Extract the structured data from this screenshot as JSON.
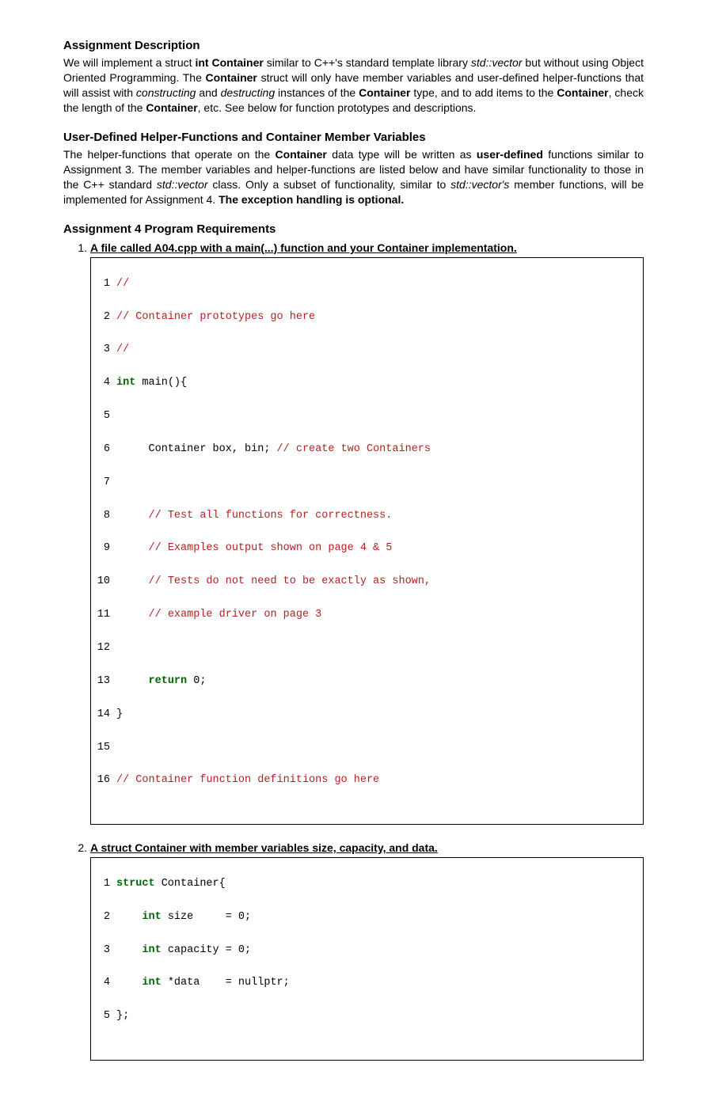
{
  "section1": {
    "title": "Assignment Description",
    "intro_before": "We will implement a struct ",
    "int_container": "int Container",
    "intro_mid1": " similar to C++'s standard template library ",
    "stdvec": "std::vector",
    "intro_mid2": " but without using Object Oriented Programming.  The ",
    "container1": "Container",
    "intro_mid3": " struct will only have member variables and user-defined helper-functions that will assist with ",
    "constructing": "constructing",
    "and": " and ",
    "destructing": "destructing",
    "intro_mid4": " instances of the ",
    "container2": "Container",
    "intro_mid5": " type, and to add items to the ",
    "container3": "Container",
    "intro_mid6": ", check the length of the ",
    "container4": "Container",
    "intro_end": ", etc.  See below for function prototypes and descriptions."
  },
  "section2": {
    "title": "User-Defined Helper-Functions and Container Member Variables",
    "p1a": "The helper-functions that operate on the ",
    "container": "Container",
    "p1b": " data type will be written as ",
    "userdef": "user-defined",
    "p1c": " functions similar to Assignment 3.  The member variables and helper-functions are listed below and have similar functionality to those in the C++ standard ",
    "stdvec": "std::vector",
    "p1d": " class.  Only a subset of functionality, similar to ",
    "stdvec2": "std::vector's",
    "p1e": " member functions, will be implemented for Assignment 4.  ",
    "excopt": "The exception handling is optional."
  },
  "section3": {
    "title": "Assignment 4 Program Requirements"
  },
  "req1": {
    "head": "A file called A04.cpp with a main(...) function and your Container implementation."
  },
  "code1": {
    "l1": {
      "n": "1",
      "c": "//"
    },
    "l2": {
      "n": "2",
      "c": "// Container prototypes go here"
    },
    "l3": {
      "n": "3",
      "c": "//"
    },
    "l4": {
      "n": "4",
      "kw": "int",
      "rest": " main(){"
    },
    "l5": {
      "n": "5",
      "t": ""
    },
    "l6": {
      "n": "6",
      "t": "     Container box, bin; ",
      "c": "// create two Containers"
    },
    "l7": {
      "n": "7",
      "t": ""
    },
    "l8": {
      "n": "8",
      "t": "     ",
      "c": "// Test all functions for correctness."
    },
    "l9": {
      "n": "9",
      "t": "     ",
      "c": "// Examples output shown on page 4 & 5"
    },
    "l10": {
      "n": "10",
      "t": "     ",
      "c": "// Tests do not need to be exactly as shown,"
    },
    "l11": {
      "n": "11",
      "t": "     ",
      "c": "// example driver on page 3"
    },
    "l12": {
      "n": "12",
      "t": ""
    },
    "l13": {
      "n": "13",
      "t": "     ",
      "kw": "return",
      "rest": " 0;"
    },
    "l14": {
      "n": "14",
      "t": "}"
    },
    "l15": {
      "n": "15",
      "t": ""
    },
    "l16": {
      "n": "16",
      "c": "// Container function definitions go here"
    }
  },
  "req2": {
    "head": "A struct Container with member variables size, capacity, and data."
  },
  "code2": {
    "l1": {
      "n": "1",
      "kw": "struct",
      "rest": " Container{"
    },
    "l2": {
      "n": "2",
      "t": "    ",
      "kw": "int",
      "rest": " size     = 0;"
    },
    "l3": {
      "n": "3",
      "t": "    ",
      "kw": "int",
      "rest": " capacity = 0;"
    },
    "l4": {
      "n": "4",
      "t": "    ",
      "kw": "int",
      "rest": " *data    = nullptr;"
    },
    "l5": {
      "n": "5",
      "t": "};"
    }
  }
}
